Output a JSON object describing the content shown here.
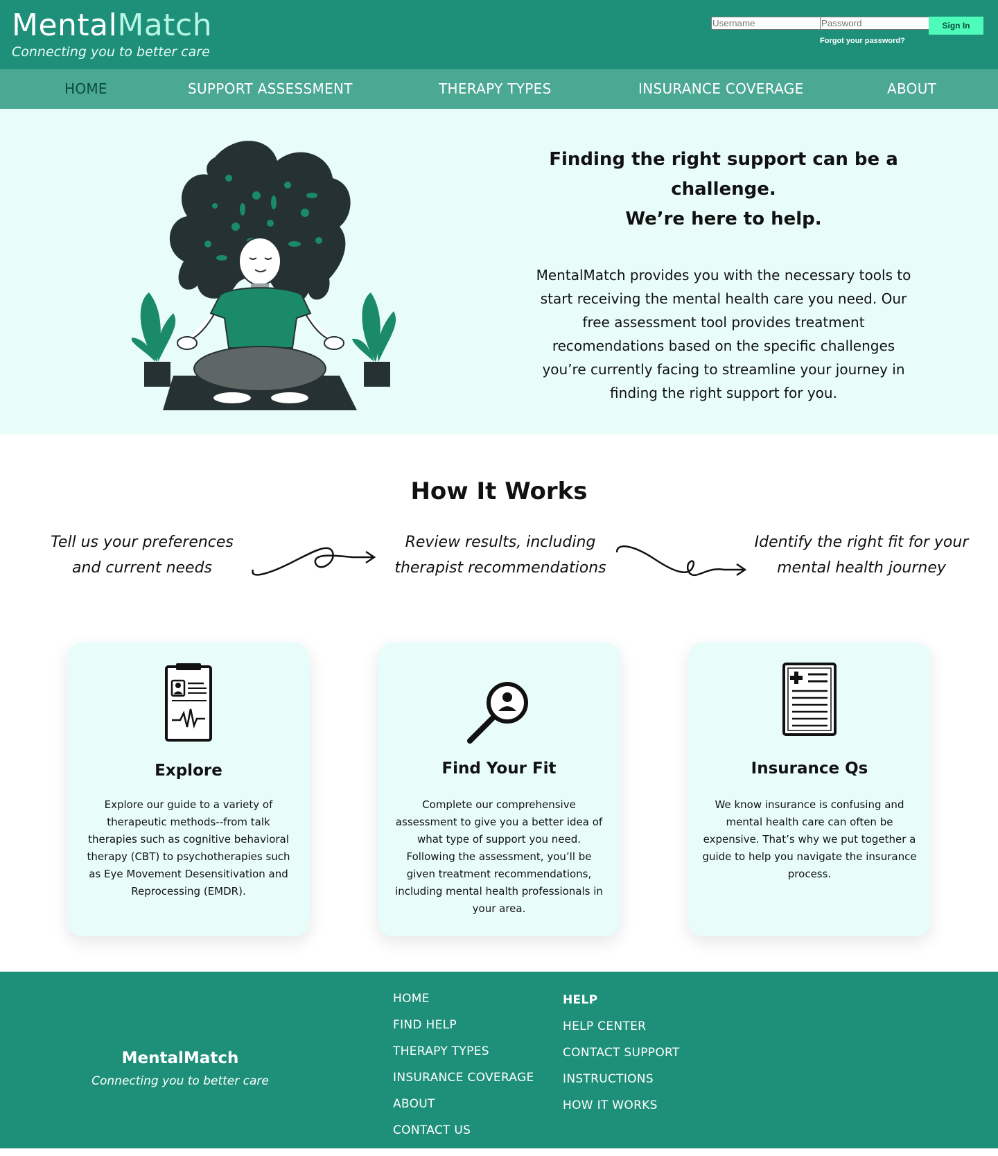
{
  "header": {
    "brand_first": "Mental",
    "brand_second": "Match",
    "tagline": "Connecting you to better care",
    "username_placeholder": "Username",
    "password_placeholder": "Password",
    "forgot_label": "Forgot your password?",
    "signin_label": "Sign In"
  },
  "nav": {
    "items": [
      {
        "label": "HOME",
        "active": true
      },
      {
        "label": "SUPPORT ASSESSMENT"
      },
      {
        "label": "THERAPY TYPES"
      },
      {
        "label": "INSURANCE COVERAGE"
      },
      {
        "label": "ABOUT"
      }
    ]
  },
  "hero": {
    "heading_line1": "Finding the right support can be a challenge.",
    "heading_line2": "We’re here to help.",
    "body": "MentalMatch provides you with the necessary tools to start receiving the mental health care you need. Our free assessment tool provides treatment recomendations based on the specific challenges you’re currently facing to streamline your journey in finding the right support for you."
  },
  "how": {
    "title": "How It Works",
    "steps": [
      "Tell us your preferences and current needs",
      "Review results, including therapist recommendations",
      "Identify the right fit for your mental health journey"
    ]
  },
  "cards": [
    {
      "icon": "clipboard-icon",
      "title": "Explore",
      "body": "Explore our guide to a variety of therapeutic methods--from talk therapies such as cognitive behavioral therapy (CBT) to psychotherapies such as Eye Movement Desensitivation and Reprocessing (EMDR)."
    },
    {
      "icon": "magnifier-icon",
      "title": "Find Your Fit",
      "body": "Complete our comprehensive assessment to give you a better idea of what type of support you need. Following the assessment, you’ll be given treatment recommendations, including mental health professionals in your area."
    },
    {
      "icon": "medical-document-icon",
      "title": "Insurance Qs",
      "body": "We know insurance is confusing and mental health care can often be expensive. That’s why we put together a guide to help you navigate the insurance process."
    }
  ],
  "footer": {
    "brand": "MentalMatch",
    "tagline": "Connecting you to better care",
    "links": [
      "HOME",
      "FIND HELP",
      "THERAPY TYPES",
      "INSURANCE COVERAGE",
      "ABOUT",
      "CONTACT US"
    ],
    "help_heading": "HELP",
    "help_links": [
      "HELP CENTER",
      "CONTACT SUPPORT",
      "INSTRUCTIONS",
      "HOW IT WORKS"
    ]
  },
  "colors": {
    "primary": "#1e9079",
    "nav": "#4ba893",
    "hero_bg": "#e8fdf9",
    "signin_bg": "#4dfcb8",
    "illustration_green": "#1a8a68",
    "hair": "#263133"
  }
}
